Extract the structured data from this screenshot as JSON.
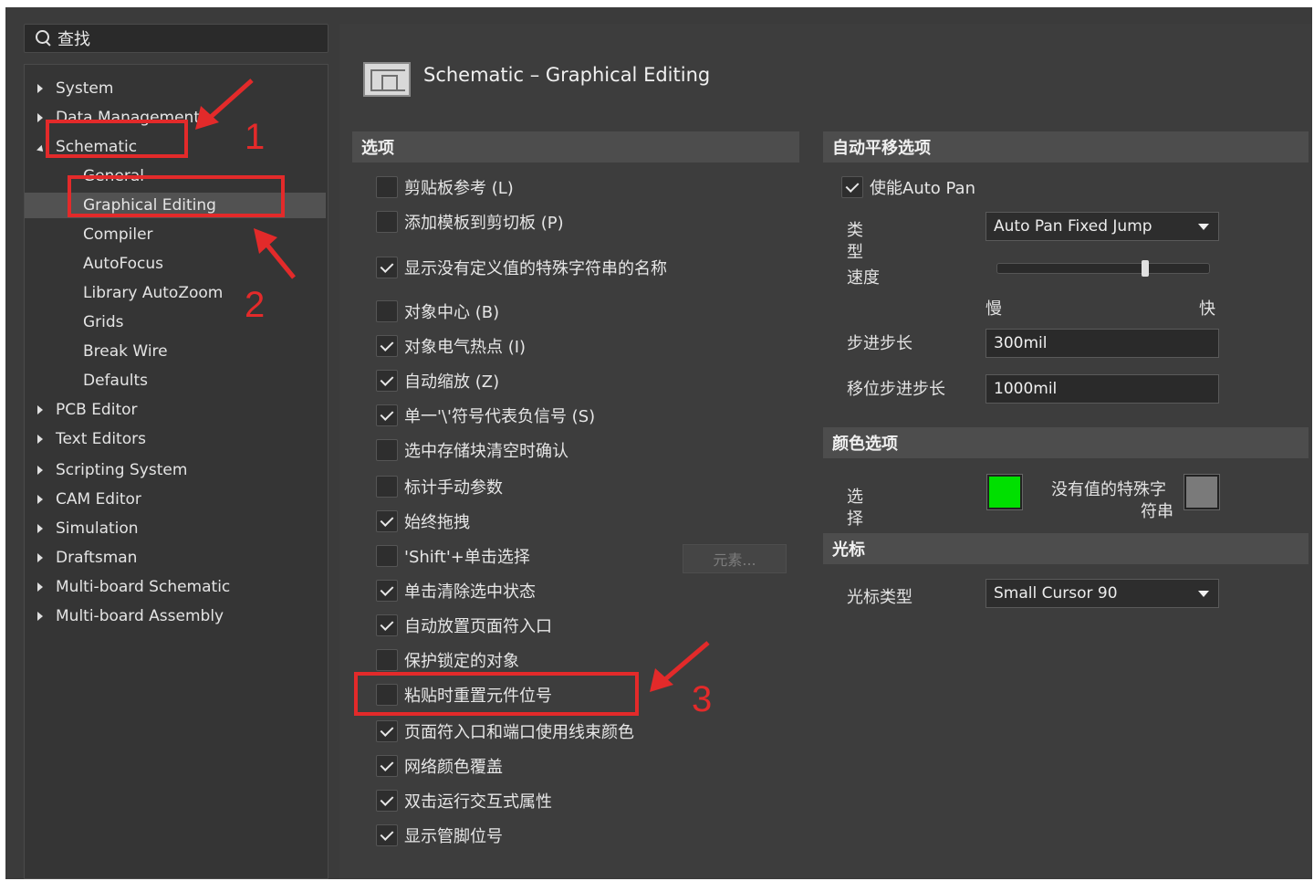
{
  "search": {
    "label": "查找"
  },
  "tree": {
    "items": [
      {
        "label": "System",
        "level": 0,
        "expanded": false
      },
      {
        "label": "Data Management",
        "level": 0,
        "expanded": false
      },
      {
        "label": "Schematic",
        "level": 0,
        "expanded": true
      },
      {
        "label": "General",
        "level": 1
      },
      {
        "label": "Graphical Editing",
        "level": 1,
        "selected": true
      },
      {
        "label": "Compiler",
        "level": 1
      },
      {
        "label": "AutoFocus",
        "level": 1
      },
      {
        "label": "Library AutoZoom",
        "level": 1
      },
      {
        "label": "Grids",
        "level": 1
      },
      {
        "label": "Break Wire",
        "level": 1
      },
      {
        "label": "Defaults",
        "level": 1
      },
      {
        "label": "PCB Editor",
        "level": 0,
        "expanded": false
      },
      {
        "label": "Text Editors",
        "level": 0,
        "expanded": false
      },
      {
        "label": "Scripting System",
        "level": 0,
        "expanded": false
      },
      {
        "label": "CAM Editor",
        "level": 0,
        "expanded": false
      },
      {
        "label": "Simulation",
        "level": 0,
        "expanded": false
      },
      {
        "label": "Draftsman",
        "level": 0,
        "expanded": false
      },
      {
        "label": "Multi-board Schematic",
        "level": 0,
        "expanded": false
      },
      {
        "label": "Multi-board Assembly",
        "level": 0,
        "expanded": false
      }
    ]
  },
  "header": {
    "title": "Schematic – Graphical Editing"
  },
  "options_section": {
    "title": "选项",
    "items": [
      {
        "label": "剪贴板参考 (L)",
        "checked": false
      },
      {
        "label": "添加模板到剪切板 (P)",
        "checked": false
      },
      {
        "label": "显示没有定义值的特殊字符串的名称",
        "checked": true
      },
      {
        "label": "对象中心 (B)",
        "checked": false
      },
      {
        "label": "对象电气热点 (I)",
        "checked": true
      },
      {
        "label": "自动缩放 (Z)",
        "checked": true
      },
      {
        "label": "单一'\\'符号代表负信号 (S)",
        "checked": true
      },
      {
        "label": "选中存储块清空时确认",
        "checked": false
      },
      {
        "label": "标计手动参数",
        "checked": false
      },
      {
        "label": "始终拖拽",
        "checked": true
      },
      {
        "label": "'Shift'+单击选择",
        "checked": false
      },
      {
        "label": "单击清除选中状态",
        "checked": true
      },
      {
        "label": "自动放置页面符入口",
        "checked": true
      },
      {
        "label": "保护锁定的对象",
        "checked": false
      },
      {
        "label": "粘贴时重置元件位号",
        "checked": false
      },
      {
        "label": "页面符入口和端口使用线束颜色",
        "checked": true
      },
      {
        "label": "网络颜色覆盖",
        "checked": true
      },
      {
        "label": "双击运行交互式属性",
        "checked": true
      },
      {
        "label": "显示管脚位号",
        "checked": true
      }
    ],
    "elements_button": "元素..."
  },
  "autopan_section": {
    "title": "自动平移选项",
    "enable_label": "使能Auto Pan",
    "enable_checked": true,
    "type_label_1": "类",
    "type_label_2": "型",
    "type_value": "Auto Pan Fixed Jump",
    "speed_label": "速度",
    "speed_value": 0.7,
    "slow_label": "慢",
    "fast_label": "快",
    "step_label": "步进步长",
    "step_value": "300mil",
    "shift_step_label": "移位步进步长",
    "shift_step_value": "1000mil"
  },
  "color_section": {
    "title": "颜色选项",
    "select_label_1": "选",
    "select_label_2": "择",
    "select_color": "#00e000",
    "special_label_1": "没有值的特殊字",
    "special_label_2": "符串",
    "special_color": "#7a7a7a"
  },
  "cursor_section": {
    "title": "光标",
    "type_label": "光标类型",
    "type_value": "Small Cursor 90"
  },
  "annotations": {
    "one": "1",
    "two": "2",
    "three": "3"
  }
}
